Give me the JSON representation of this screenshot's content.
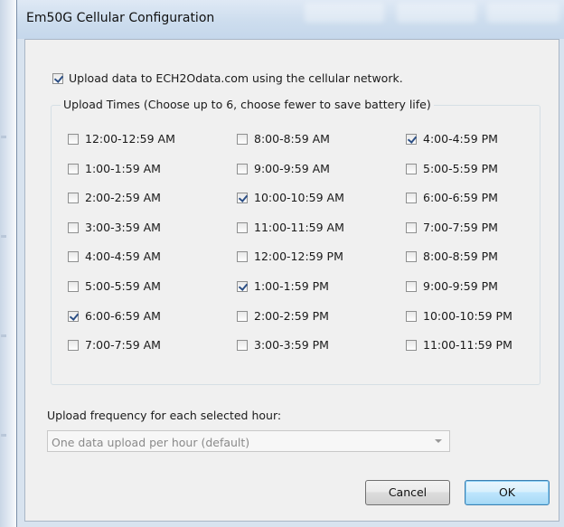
{
  "window": {
    "title": "Em50G Cellular Configuration"
  },
  "upload": {
    "label": "Upload data to ECH2Odata.com using the cellular network.",
    "checked": true
  },
  "upload_times": {
    "legend": "Upload Times (Choose up to 6, choose fewer to save battery life)",
    "columns": [
      [
        {
          "label": "12:00-12:59 AM",
          "checked": false
        },
        {
          "label": "1:00-1:59 AM",
          "checked": false
        },
        {
          "label": "2:00-2:59 AM",
          "checked": false
        },
        {
          "label": "3:00-3:59 AM",
          "checked": false
        },
        {
          "label": "4:00-4:59 AM",
          "checked": false
        },
        {
          "label": "5:00-5:59 AM",
          "checked": false
        },
        {
          "label": "6:00-6:59 AM",
          "checked": true
        },
        {
          "label": "7:00-7:59 AM",
          "checked": false
        }
      ],
      [
        {
          "label": "8:00-8:59 AM",
          "checked": false
        },
        {
          "label": "9:00-9:59 AM",
          "checked": false
        },
        {
          "label": "10:00-10:59 AM",
          "checked": true
        },
        {
          "label": "11:00-11:59 AM",
          "checked": false
        },
        {
          "label": "12:00-12:59 PM",
          "checked": false
        },
        {
          "label": "1:00-1:59 PM",
          "checked": true
        },
        {
          "label": "2:00-2:59 PM",
          "checked": false
        },
        {
          "label": "3:00-3:59 PM",
          "checked": false
        }
      ],
      [
        {
          "label": "4:00-4:59 PM",
          "checked": true
        },
        {
          "label": "5:00-5:59 PM",
          "checked": false
        },
        {
          "label": "6:00-6:59 PM",
          "checked": false
        },
        {
          "label": "7:00-7:59 PM",
          "checked": false
        },
        {
          "label": "8:00-8:59 PM",
          "checked": false
        },
        {
          "label": "9:00-9:59 PM",
          "checked": false
        },
        {
          "label": "10:00-10:59 PM",
          "checked": false
        },
        {
          "label": "11:00-11:59 PM",
          "checked": false
        }
      ]
    ]
  },
  "frequency": {
    "label": "Upload frequency for each selected hour:",
    "selected": "One data upload per hour (default)"
  },
  "buttons": {
    "cancel": "Cancel",
    "ok": "OK"
  }
}
